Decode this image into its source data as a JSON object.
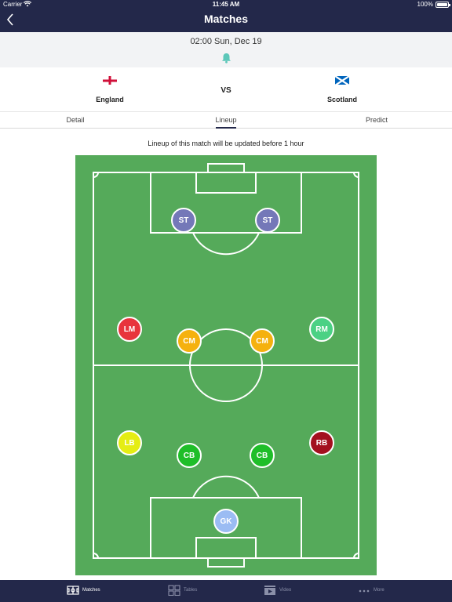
{
  "status_bar": {
    "carrier": "Carrier",
    "time": "11:45 AM",
    "battery": "100%"
  },
  "nav": {
    "title": "Matches"
  },
  "match": {
    "datetime": "02:00 Sun, Dec 19",
    "home": "England",
    "away": "Scotland",
    "vs": "VS"
  },
  "tabs": [
    {
      "label": "Detail"
    },
    {
      "label": "Lineup"
    },
    {
      "label": "Predict"
    }
  ],
  "notice": "Lineup of this match will be updated before 1 hour",
  "players": [
    {
      "role": "ST",
      "color": "#7478b8"
    },
    {
      "role": "ST",
      "color": "#7478b8"
    },
    {
      "role": "LM",
      "color": "#e8343c"
    },
    {
      "role": "CM",
      "color": "#f5b10e"
    },
    {
      "role": "CM",
      "color": "#f5b10e"
    },
    {
      "role": "RM",
      "color": "#4bd184"
    },
    {
      "role": "LB",
      "color": "#e5ed13"
    },
    {
      "role": "CB",
      "color": "#1fbe29"
    },
    {
      "role": "CB",
      "color": "#1fbe29"
    },
    {
      "role": "RB",
      "color": "#a3101f"
    },
    {
      "role": "GK",
      "color": "#9bbcf3"
    }
  ],
  "bottom_tabs": [
    {
      "label": "Matches",
      "icon": "pitch-icon"
    },
    {
      "label": "Tables",
      "icon": "grid-icon"
    },
    {
      "label": "Video",
      "icon": "video-icon"
    },
    {
      "label": "More",
      "icon": "more-icon"
    }
  ],
  "colors": {
    "nav": "#23284a",
    "pitch": "#55aa5a",
    "bell": "#5cc7b9",
    "tab_active": "#ffffff",
    "tab_inactive": "#8a8fa8"
  }
}
